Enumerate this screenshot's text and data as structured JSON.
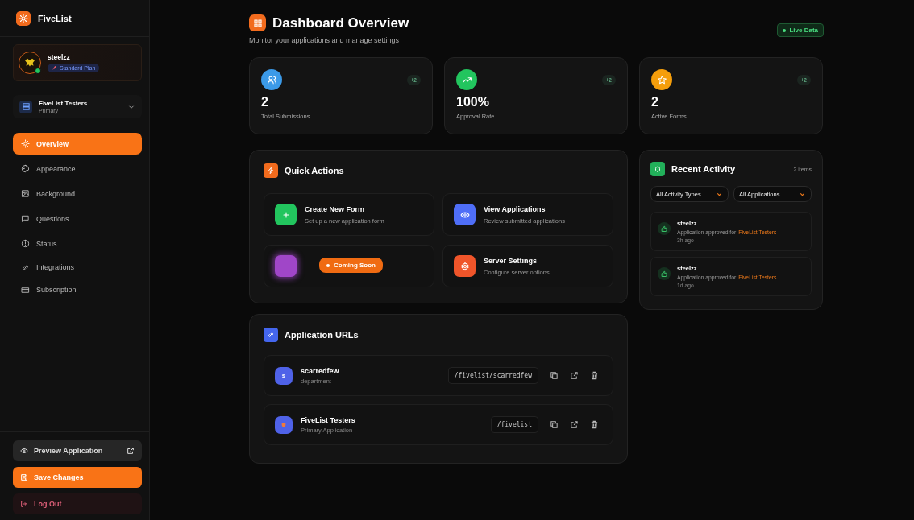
{
  "brand": {
    "name": "FiveList"
  },
  "user": {
    "name": "steelzz",
    "plan": "Standard Plan",
    "online": true
  },
  "server": {
    "name": "FiveList Testers",
    "role": "Primary"
  },
  "nav": [
    {
      "label": "Overview",
      "selected": true
    },
    {
      "label": "Appearance",
      "selected": false
    },
    {
      "label": "Background",
      "selected": false
    },
    {
      "label": "Questions",
      "selected": false
    },
    {
      "label": "Status",
      "selected": false
    },
    {
      "label": "Integrations",
      "selected": false
    },
    {
      "label": "Subscription",
      "selected": false
    }
  ],
  "sidebar_actions": [
    {
      "label": "Preview Application",
      "kind": "preview"
    },
    {
      "label": "Save Changes",
      "kind": "save"
    },
    {
      "label": "Log Out",
      "kind": "logout"
    }
  ],
  "header": {
    "title": "Dashboard Overview",
    "subtitle": "Monitor your applications and manage settings",
    "badge": "Live Data"
  },
  "stats": [
    {
      "value": "2",
      "label": "Total Submissions",
      "delta": "+2",
      "color": "#3b9ae8"
    },
    {
      "value": "100%",
      "label": "Approval Rate",
      "delta": "+2",
      "color": "#22c55e"
    },
    {
      "value": "2",
      "label": "Active Forms",
      "delta": "+2",
      "color": "#f59e0b"
    }
  ],
  "quick_actions": {
    "title": "Quick Actions",
    "items": [
      {
        "kind": "action",
        "title": "Create New Form",
        "desc": "Set up a new application form",
        "color": "#22c55e"
      },
      {
        "kind": "action",
        "title": "View Applications",
        "desc": "Review submitted applications",
        "color": "#4f6ef7"
      },
      {
        "kind": "soon",
        "badge": "Coming Soon",
        "color": "#a046c8"
      },
      {
        "kind": "action",
        "title": "Server Settings",
        "desc": "Configure server options",
        "color": "#f0552a"
      }
    ]
  },
  "activity": {
    "title": "Recent Activity",
    "count": "2 items",
    "filters": [
      "All Activity Types",
      "All Applications"
    ],
    "items": [
      {
        "user": "steelzz",
        "text": "Application approved for",
        "target": "FiveList Testers",
        "time": "3h ago"
      },
      {
        "user": "steelzz",
        "text": "Application approved for",
        "target": "FiveList Testers",
        "time": "1d ago"
      }
    ]
  },
  "urls": {
    "title": "Application URLs",
    "items": [
      {
        "initial": "s",
        "name": "scarredfew",
        "sub": "department",
        "path": "/fivelist/scarredfew"
      },
      {
        "name": "FiveList Testers",
        "sub": "Primary Application",
        "path": "/fivelist"
      }
    ]
  }
}
